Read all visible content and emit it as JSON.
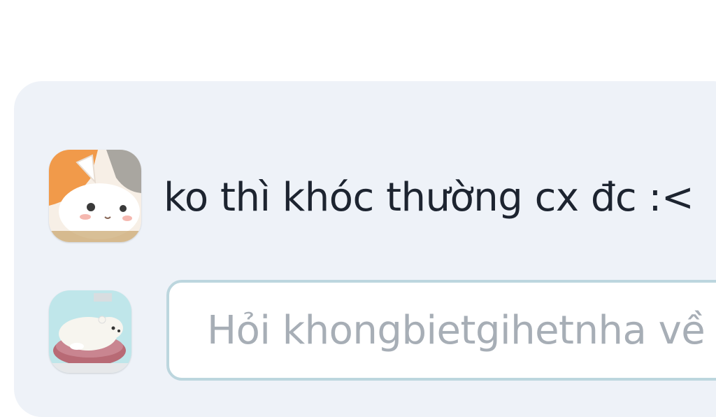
{
  "comment": {
    "text": "ko thì khóc thường cx đc :<",
    "author_avatar_icon": "calico-cat-avatar-icon"
  },
  "composer": {
    "placeholder": "Hỏi khongbietgihetnha về",
    "user_avatar_icon": "sleeping-polar-bear-avatar-icon"
  },
  "colors": {
    "panel_bg": "#eef2f8",
    "input_border": "#bcd6de",
    "text": "#1d2430",
    "placeholder": "#a7aeb6"
  }
}
